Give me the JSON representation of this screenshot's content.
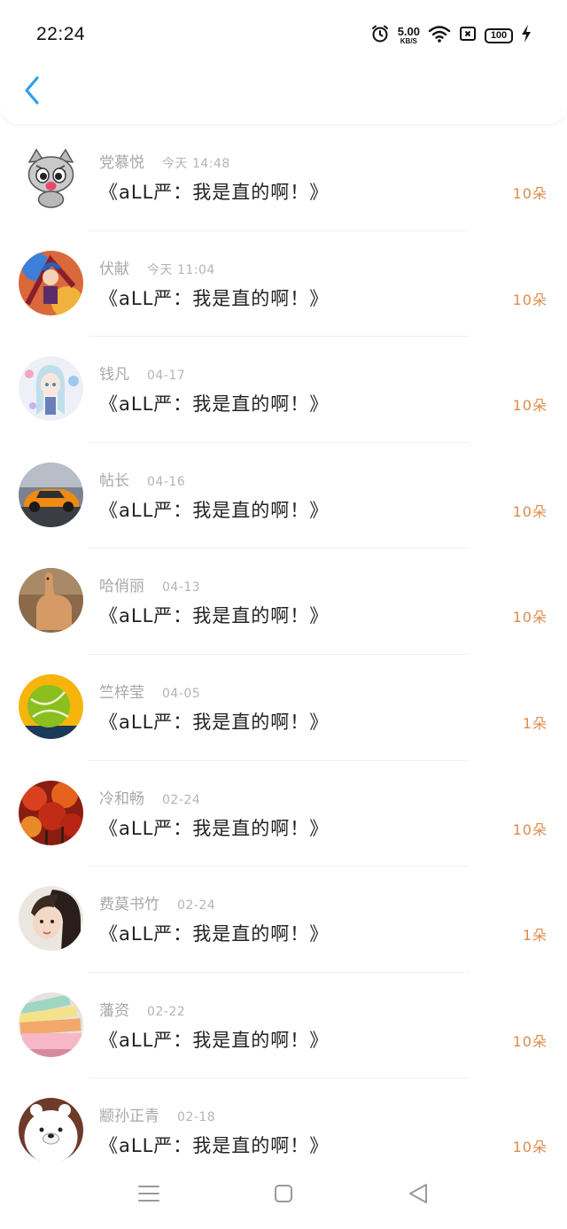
{
  "status_bar": {
    "time": "22:24",
    "net_speed": "5.00",
    "net_unit": "KB/S",
    "battery": "100",
    "icons": [
      "alarm-icon",
      "wifi-icon",
      "sim-icon",
      "battery-icon",
      "charging-icon"
    ]
  },
  "header": {
    "back_icon": "chevron-left-icon"
  },
  "colors": {
    "accent": "#2f9fe8",
    "count": "#e08a4a"
  },
  "items": [
    {
      "name": "党慕悦",
      "time": "今天 14:48",
      "title": "《aLL严：我是直的啊！》",
      "count": "10朵"
    },
    {
      "name": "伏献",
      "time": "今天 11:04",
      "title": "《aLL严：我是直的啊！》",
      "count": "10朵"
    },
    {
      "name": "钱凡",
      "time": "04-17",
      "title": "《aLL严：我是直的啊！》",
      "count": "10朵"
    },
    {
      "name": "帖长",
      "time": "04-16",
      "title": "《aLL严：我是直的啊！》",
      "count": "10朵"
    },
    {
      "name": "哈俏丽",
      "time": "04-13",
      "title": "《aLL严：我是直的啊！》",
      "count": "10朵"
    },
    {
      "name": "竺梓莹",
      "time": "04-05",
      "title": "《aLL严：我是直的啊！》",
      "count": "1朵"
    },
    {
      "name": "冷和畅",
      "time": "02-24",
      "title": "《aLL严：我是直的啊！》",
      "count": "10朵"
    },
    {
      "name": "费莫书竹",
      "time": "02-24",
      "title": "《aLL严：我是直的啊！》",
      "count": "1朵"
    },
    {
      "name": "藩资",
      "time": "02-22",
      "title": "《aLL严：我是直的啊！》",
      "count": "10朵"
    },
    {
      "name": "颛孙正青",
      "time": "02-18",
      "title": "《aLL严：我是直的啊！》",
      "count": "10朵"
    }
  ],
  "nav": {
    "icons": [
      "menu-icon",
      "home-square-icon",
      "back-triangle-icon"
    ]
  }
}
